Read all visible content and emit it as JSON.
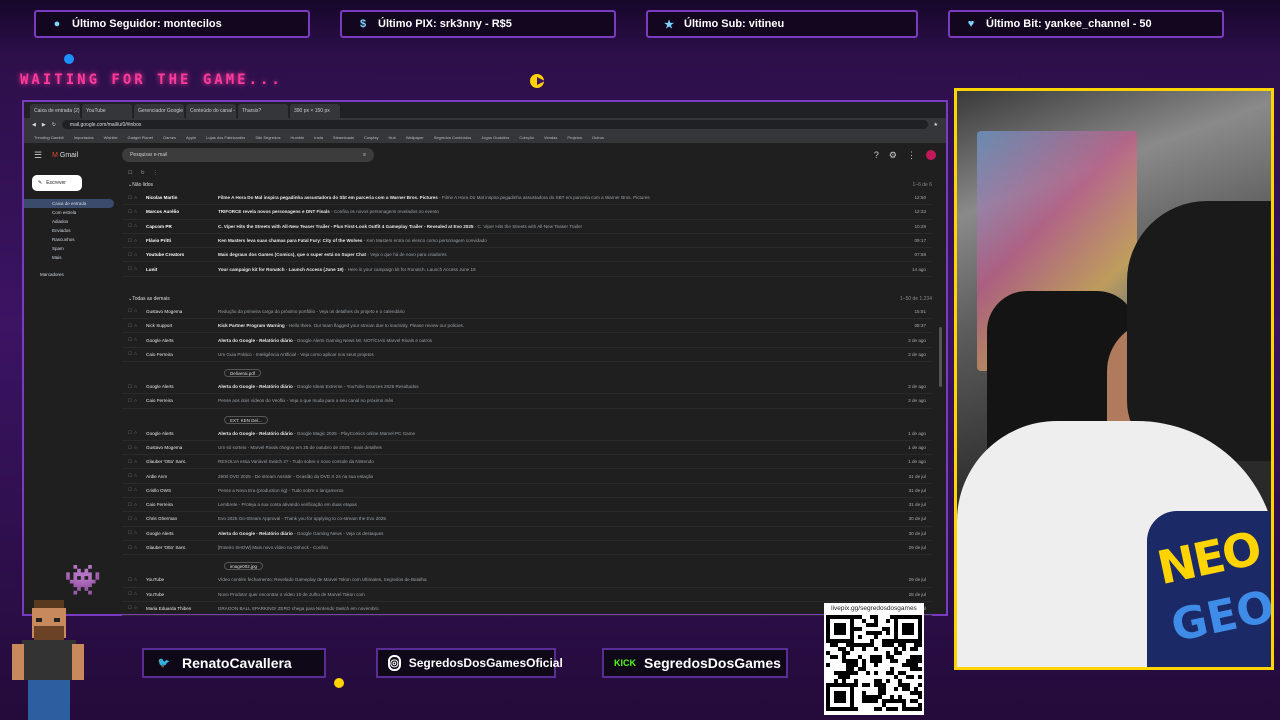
{
  "overlay": {
    "tickers": [
      {
        "icon": "user-icon",
        "label": "Último Seguidor: montecilos"
      },
      {
        "icon": "dollar-icon",
        "label": "Último PIX: srk3nny - R$5"
      },
      {
        "icon": "star-icon",
        "label": "Último Sub: vitineu"
      },
      {
        "icon": "heart-icon",
        "label": "Último Bit: yankee_channel - 50"
      }
    ],
    "waiting_text": "WAITING FOR THE GAME...",
    "socials": [
      {
        "icon": "twitter-icon",
        "label": "RenatoCavallera"
      },
      {
        "icon": "instagram-icon",
        "label": "SegredosDosGamesOficial"
      },
      {
        "icon": "kick-icon",
        "icon_text": "KICK",
        "label": "SegredosDosGames"
      }
    ],
    "qr_label": "livepix.gg/segredosdosgames",
    "webcam_shirt_text": "NEO GEO",
    "colors": {
      "accent": "#7a3bc1",
      "cam_border": "#ffd400",
      "waiting": "#ff3a9c"
    }
  },
  "browser": {
    "tabs": [
      "Caixa de entrada (2) - segredos",
      "YouTube",
      "Gerenciador Google",
      "Conteúdo do canal - YouTube",
      "Tharsis?",
      "390 px × 150 px"
    ],
    "url": "mail.google.com/mail/u/0/#inbox",
    "bookmarks": [
      "Trending Gambit",
      "Importados",
      "Wishlist",
      "Gadget Planet",
      "Games",
      "Apple",
      "Lojas dos Fabricantes",
      "Site Segredos",
      "Humble",
      "Insta",
      "Steamloads",
      "Cosplay",
      "Hub",
      "Wallpaper",
      "Segredos Conteúdos",
      "Jogos Gratuitos",
      "Coleção",
      "Vendas",
      "Projetos",
      "Outros"
    ]
  },
  "gmail": {
    "app_name": "Gmail",
    "search_placeholder": "Pesquisar e-mail",
    "compose": "Escrever",
    "sidebar": [
      {
        "label": "Caixa de entrada",
        "active": true
      },
      {
        "label": "Com estrela",
        "active": false
      },
      {
        "label": "Adiados",
        "active": false
      },
      {
        "label": "Enviados",
        "active": false
      },
      {
        "label": "Rascunhos",
        "active": false
      },
      {
        "label": "Spam",
        "active": false
      },
      {
        "label": "Mais",
        "active": false
      }
    ],
    "labels_heading": "Marcadores",
    "unread_heading": "Não lidos",
    "unread_count": "1–6 de 6",
    "all_heading": "Todas as demais",
    "all_count": "1–50 de 1.234",
    "unread": [
      {
        "sender": "Nicolas Martin",
        "subject": "Filme A Hora Do Mal inspira pegadinha assustadora do Sbt em parceria com a Warner Bros. Pictures",
        "snippet": " - Filme A Hora Do Mal inspira pegadinha assustadora do SBT em parceria com a Warner Bros. Pictures",
        "date": "12:50"
      },
      {
        "sender": "Marcos Aurélio",
        "subject": "TRIFORCE revela novos personagens e DNT Finals",
        "snippet": " - Confira os novos personagens revelados no evento",
        "date": "12:33"
      },
      {
        "sender": "Capcom PR",
        "subject": "C. Viper Hits the Streets with All-New Teaser Trailer - Plus First-Look Outfit 4 Gameplay Trailer - Revealed at Evo 2025",
        "snippet": " - C. Viper Hits the Streets with All-New Teaser Trailer",
        "date": "10:28"
      },
      {
        "sender": "Flávio Pritti",
        "subject": "Ken Masters leva suas chamas para Fatal Fury: City of the Wolves",
        "snippet": " - Ken Masters entra no elenco como personagem convidado",
        "date": "09:17"
      },
      {
        "sender": "Youtube Creators",
        "subject": "Mais degraus dos Games (Comics), que o super está no Super Chat",
        "snippet": " - Veja o que há de novo para criadores",
        "date": "07:58"
      },
      {
        "sender": "Lunit",
        "subject": "Your campaign kit for Ronatch · Launch Access (June 19)",
        "snippet": " - Here is your campaign kit for Ronatch. Launch Access June 19",
        "date": "14 ago"
      }
    ],
    "all": [
      {
        "sender": "Gustavo Mogema",
        "subject": "",
        "snippet": "Redução da primeira carga do próximo portfólio - Veja os detalhes do projeto e o calendário",
        "date": "15:51",
        "attachment": ""
      },
      {
        "sender": "Nick Support",
        "subject": "Kick Partner Program Warning",
        "snippet": " - Hello there. Our team flagged your stream due to inactivity. Please review our policies.",
        "date": "08:37",
        "attachment": ""
      },
      {
        "sender": "Google Alerts",
        "subject": "Alerta do Google - Relatório diário",
        "snippet": " - Google Alerts Gaming News Mr. NOTÍCIAS Marvel Rivals e outros",
        "date": "3 de ago",
        "attachment": ""
      },
      {
        "sender": "Caio Ferreira",
        "subject": "",
        "snippet": "Um Guia Prático - Inteligência Artificial - Veja como aplicar nos seus projetos",
        "date": "3 de ago",
        "attachment": "Deliverai.pdf"
      },
      {
        "sender": "Google Alerts",
        "subject": "Alerta do Google - Relatório diário",
        "snippet": " - Google Ideas Extreme - YouTube Sources 2025 Resultados",
        "date": "3 de ago",
        "attachment": ""
      },
      {
        "sender": "Caio Ferreira",
        "subject": "",
        "snippet": "Pense aos dois vídeos do Veoflix - Veja o que muda para o seu canal no próximo mês",
        "date": "3 de ago",
        "attachment": "EXT. KEN Del..."
      },
      {
        "sender": "Google Alerts",
        "subject": "Alerta do Google - Relatório diário",
        "snippet": " - Google Magic 2025 - PlayComics online Marvel PC Game",
        "date": "1 de ago",
        "attachment": ""
      },
      {
        "sender": "Gustavo Mogema",
        "subject": "",
        "snippet": "Um só sorteio - Marvel Rivals chegou em 25 de outubro de 2025 - mais detalhes",
        "date": "1 de ago",
        "attachment": ""
      },
      {
        "sender": "Glauber 'Otto' Sant.",
        "subject": "",
        "snippet": "RESOLVA essa Variável Switch 2? - Tudo sobre o novo console da Nintendo",
        "date": "1 de ago",
        "attachment": ""
      },
      {
        "sender": "Ardie Anm",
        "subject": "",
        "snippet": "2900 DVD 2025 - De stream Assistir - Ocasião da DVD X 24 na sua estação",
        "date": "31 de jul",
        "attachment": ""
      },
      {
        "sender": "Crisllo OWS",
        "subject": "",
        "snippet": "Pense a Nova Era (production rig) - Tudo sobre o lançamento",
        "date": "31 de jul",
        "attachment": ""
      },
      {
        "sender": "Caio Ferreira",
        "subject": "",
        "snippet": "Lembrete - Proteja a sua conta ativando verificação em duas etapas",
        "date": "31 de jul",
        "attachment": ""
      },
      {
        "sender": "Chris Gherman",
        "subject": "",
        "snippet": "Evo 2025 Go-Stream Approval - Thank you for applying to co-stream the Evo 2025",
        "date": "30 de jul",
        "attachment": ""
      },
      {
        "sender": "Google Alerts",
        "subject": "Alerta do Google - Relatório diário",
        "snippet": " - Google Gaming News - Veja os destaques",
        "date": "30 de jul",
        "attachment": ""
      },
      {
        "sender": "Glauber 'Otto' Sant.",
        "subject": "",
        "snippet": "[Roteiro SHOW] Mais novo vídeo na Gshock - Confira",
        "date": "29 de jul",
        "attachment": "image002.jpg"
      },
      {
        "sender": "YouTube",
        "subject": "",
        "snippet": "Vídeo contém fechamento: Revelado Gameplay de Marvel Tokon com Ultimates, Segredos de Batalha",
        "date": "29 de jul",
        "attachment": ""
      },
      {
        "sender": "YouTube",
        "subject": "",
        "snippet": "Novo Produto! quer encontrar o vídeo 10 de Julho de Marvel Tokon com",
        "date": "28 de jul",
        "attachment": ""
      },
      {
        "sender": "Maria Eduarda Thibes",
        "subject": "",
        "snippet": "DRAGON BALL SPARKING! ZERO chega para Nintendo Switch em novembro",
        "date": "28 de jul",
        "attachment": ""
      }
    ]
  }
}
